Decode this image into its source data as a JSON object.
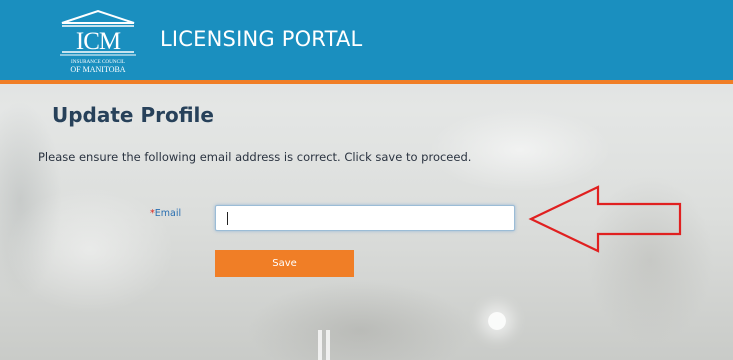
{
  "header": {
    "logo_text": "ICM",
    "logo_subtext_line1": "INSURANCE COUNCIL",
    "logo_subtext_line2": "OF MANITOBA",
    "portal_title": "LICENSING PORTAL"
  },
  "main": {
    "title": "Update Profile",
    "instructions": "Please ensure the following email address is correct. Click save to proceed.",
    "email_field": {
      "required_mark": "*",
      "label": "Email",
      "value": "",
      "placeholder": ""
    },
    "save_label": "Save"
  },
  "annotation": {
    "type": "arrow",
    "color": "#e02020",
    "points_to": "email-input"
  },
  "colors": {
    "header_bg": "#1a8fbf",
    "accent": "#f07e26",
    "title_text": "#27415a",
    "label_text": "#2a6fb0",
    "required": "#d9251c"
  }
}
